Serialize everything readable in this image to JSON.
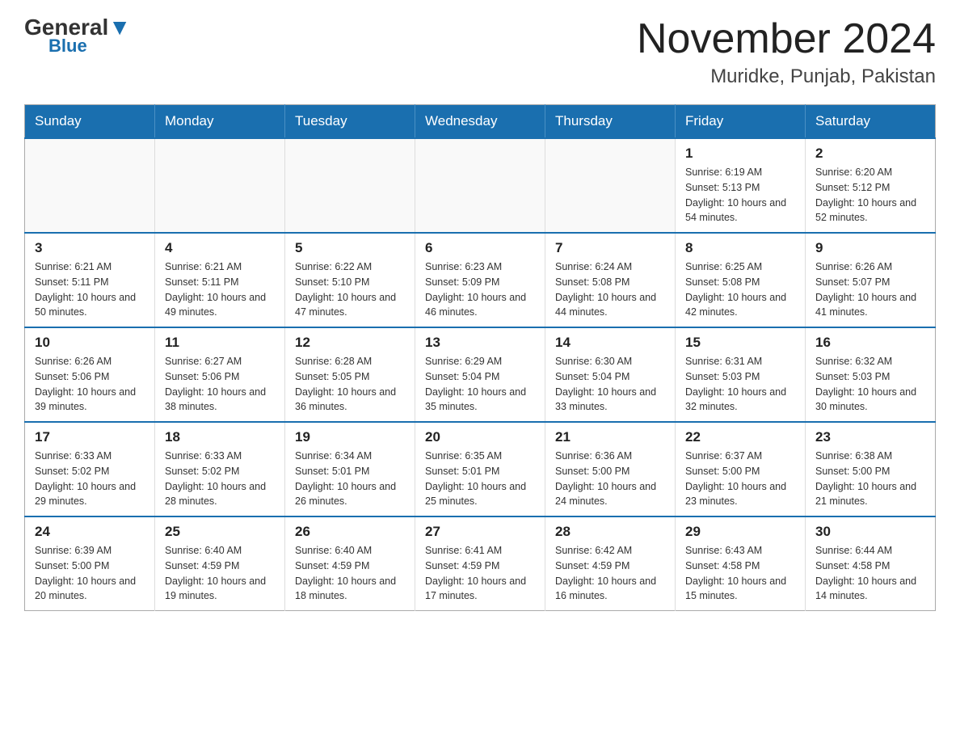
{
  "header": {
    "logo_general": "General",
    "logo_blue": "Blue",
    "title": "November 2024",
    "subtitle": "Muridke, Punjab, Pakistan"
  },
  "weekdays": [
    "Sunday",
    "Monday",
    "Tuesday",
    "Wednesday",
    "Thursday",
    "Friday",
    "Saturday"
  ],
  "weeks": [
    [
      {
        "day": "",
        "info": ""
      },
      {
        "day": "",
        "info": ""
      },
      {
        "day": "",
        "info": ""
      },
      {
        "day": "",
        "info": ""
      },
      {
        "day": "",
        "info": ""
      },
      {
        "day": "1",
        "info": "Sunrise: 6:19 AM\nSunset: 5:13 PM\nDaylight: 10 hours and 54 minutes."
      },
      {
        "day": "2",
        "info": "Sunrise: 6:20 AM\nSunset: 5:12 PM\nDaylight: 10 hours and 52 minutes."
      }
    ],
    [
      {
        "day": "3",
        "info": "Sunrise: 6:21 AM\nSunset: 5:11 PM\nDaylight: 10 hours and 50 minutes."
      },
      {
        "day": "4",
        "info": "Sunrise: 6:21 AM\nSunset: 5:11 PM\nDaylight: 10 hours and 49 minutes."
      },
      {
        "day": "5",
        "info": "Sunrise: 6:22 AM\nSunset: 5:10 PM\nDaylight: 10 hours and 47 minutes."
      },
      {
        "day": "6",
        "info": "Sunrise: 6:23 AM\nSunset: 5:09 PM\nDaylight: 10 hours and 46 minutes."
      },
      {
        "day": "7",
        "info": "Sunrise: 6:24 AM\nSunset: 5:08 PM\nDaylight: 10 hours and 44 minutes."
      },
      {
        "day": "8",
        "info": "Sunrise: 6:25 AM\nSunset: 5:08 PM\nDaylight: 10 hours and 42 minutes."
      },
      {
        "day": "9",
        "info": "Sunrise: 6:26 AM\nSunset: 5:07 PM\nDaylight: 10 hours and 41 minutes."
      }
    ],
    [
      {
        "day": "10",
        "info": "Sunrise: 6:26 AM\nSunset: 5:06 PM\nDaylight: 10 hours and 39 minutes."
      },
      {
        "day": "11",
        "info": "Sunrise: 6:27 AM\nSunset: 5:06 PM\nDaylight: 10 hours and 38 minutes."
      },
      {
        "day": "12",
        "info": "Sunrise: 6:28 AM\nSunset: 5:05 PM\nDaylight: 10 hours and 36 minutes."
      },
      {
        "day": "13",
        "info": "Sunrise: 6:29 AM\nSunset: 5:04 PM\nDaylight: 10 hours and 35 minutes."
      },
      {
        "day": "14",
        "info": "Sunrise: 6:30 AM\nSunset: 5:04 PM\nDaylight: 10 hours and 33 minutes."
      },
      {
        "day": "15",
        "info": "Sunrise: 6:31 AM\nSunset: 5:03 PM\nDaylight: 10 hours and 32 minutes."
      },
      {
        "day": "16",
        "info": "Sunrise: 6:32 AM\nSunset: 5:03 PM\nDaylight: 10 hours and 30 minutes."
      }
    ],
    [
      {
        "day": "17",
        "info": "Sunrise: 6:33 AM\nSunset: 5:02 PM\nDaylight: 10 hours and 29 minutes."
      },
      {
        "day": "18",
        "info": "Sunrise: 6:33 AM\nSunset: 5:02 PM\nDaylight: 10 hours and 28 minutes."
      },
      {
        "day": "19",
        "info": "Sunrise: 6:34 AM\nSunset: 5:01 PM\nDaylight: 10 hours and 26 minutes."
      },
      {
        "day": "20",
        "info": "Sunrise: 6:35 AM\nSunset: 5:01 PM\nDaylight: 10 hours and 25 minutes."
      },
      {
        "day": "21",
        "info": "Sunrise: 6:36 AM\nSunset: 5:00 PM\nDaylight: 10 hours and 24 minutes."
      },
      {
        "day": "22",
        "info": "Sunrise: 6:37 AM\nSunset: 5:00 PM\nDaylight: 10 hours and 23 minutes."
      },
      {
        "day": "23",
        "info": "Sunrise: 6:38 AM\nSunset: 5:00 PM\nDaylight: 10 hours and 21 minutes."
      }
    ],
    [
      {
        "day": "24",
        "info": "Sunrise: 6:39 AM\nSunset: 5:00 PM\nDaylight: 10 hours and 20 minutes."
      },
      {
        "day": "25",
        "info": "Sunrise: 6:40 AM\nSunset: 4:59 PM\nDaylight: 10 hours and 19 minutes."
      },
      {
        "day": "26",
        "info": "Sunrise: 6:40 AM\nSunset: 4:59 PM\nDaylight: 10 hours and 18 minutes."
      },
      {
        "day": "27",
        "info": "Sunrise: 6:41 AM\nSunset: 4:59 PM\nDaylight: 10 hours and 17 minutes."
      },
      {
        "day": "28",
        "info": "Sunrise: 6:42 AM\nSunset: 4:59 PM\nDaylight: 10 hours and 16 minutes."
      },
      {
        "day": "29",
        "info": "Sunrise: 6:43 AM\nSunset: 4:58 PM\nDaylight: 10 hours and 15 minutes."
      },
      {
        "day": "30",
        "info": "Sunrise: 6:44 AM\nSunset: 4:58 PM\nDaylight: 10 hours and 14 minutes."
      }
    ]
  ]
}
